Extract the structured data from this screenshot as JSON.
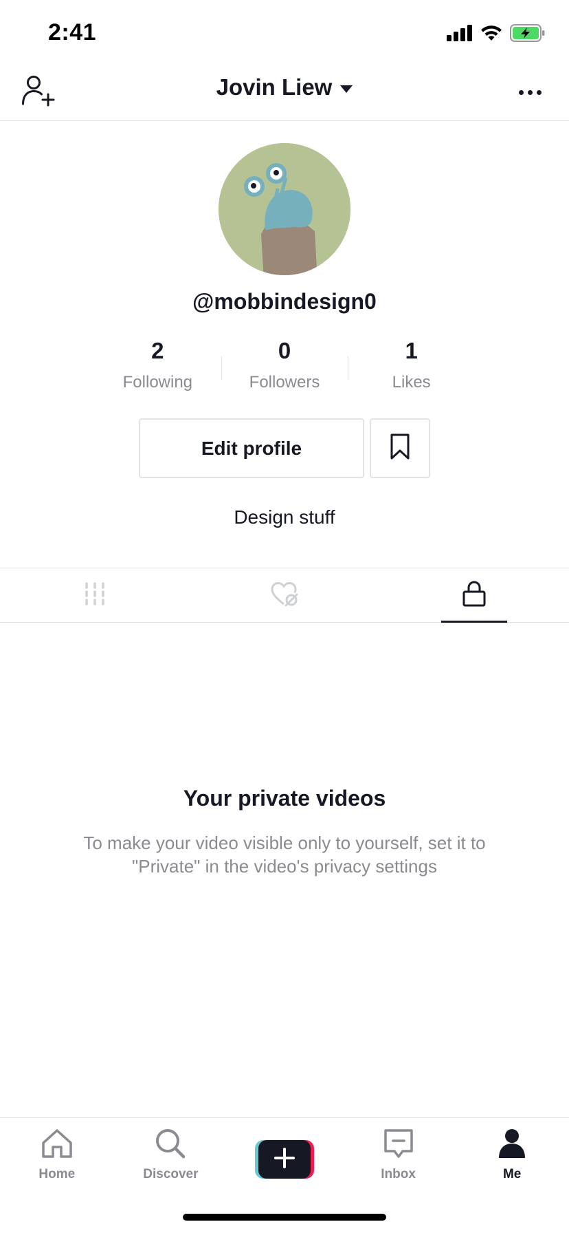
{
  "status_bar": {
    "time": "2:41"
  },
  "header": {
    "account_name": "Jovin Liew"
  },
  "profile": {
    "handle": "@mobbindesign0",
    "stats": [
      {
        "value": "2",
        "label": "Following"
      },
      {
        "value": "0",
        "label": "Followers"
      },
      {
        "value": "1",
        "label": "Likes"
      }
    ],
    "edit_button_label": "Edit profile",
    "bio": "Design stuff"
  },
  "tabs": [
    {
      "icon": "grid-icon",
      "active": false
    },
    {
      "icon": "liked-hidden-icon",
      "active": false
    },
    {
      "icon": "lock-icon",
      "active": true
    }
  ],
  "empty_state": {
    "title": "Your private videos",
    "description": "To make your video visible only to yourself, set it to \"Private\" in the video's privacy settings"
  },
  "bottom_nav": {
    "items": [
      {
        "label": "Home",
        "icon": "home-icon"
      },
      {
        "label": "Discover",
        "icon": "search-icon"
      },
      {
        "label": "",
        "icon": "plus-icon"
      },
      {
        "label": "Inbox",
        "icon": "inbox-icon"
      },
      {
        "label": "Me",
        "icon": "person-icon"
      }
    ]
  },
  "colors": {
    "text_primary": "#161823",
    "text_secondary": "#8a8b91",
    "divider": "#e3e3e4",
    "avatar_bg": "#b5c294",
    "battery_green": "#4cd964",
    "create_cyan": "#69c9d0",
    "create_pink": "#ee1d52"
  }
}
